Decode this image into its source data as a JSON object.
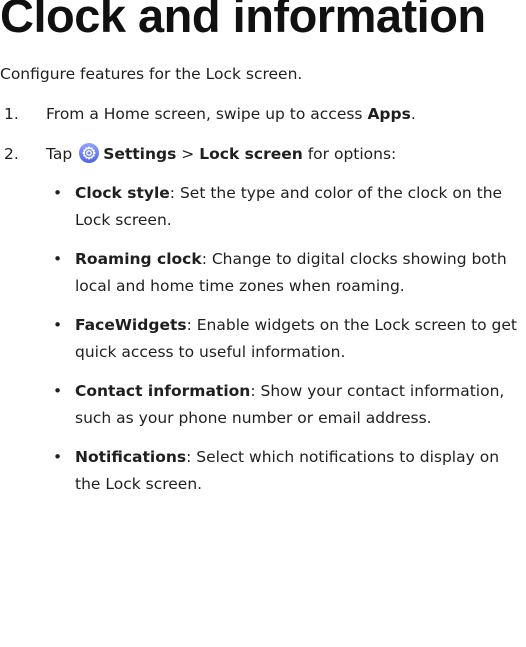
{
  "title": "Clock and information",
  "intro": "Configure features for the Lock screen.",
  "steps": [
    {
      "number": "1.",
      "text": "From a Home screen, swipe up to access ",
      "bold": "Apps",
      "suffix": "."
    },
    {
      "number": "2.",
      "tap": "Tap",
      "icon": "settings-gear-icon",
      "settings": "Settings",
      "separator": ">",
      "lock_screen": "Lock screen",
      "suffix": "for options:"
    }
  ],
  "bullets": [
    {
      "term": "Clock style",
      "desc": ": Set the type and color of the clock on the Lock screen."
    },
    {
      "term": "Roaming clock",
      "desc": ": Change to digital clocks showing both local and home time zones when roaming."
    },
    {
      "term": "FaceWidgets",
      "desc": ": Enable widgets on the Lock screen to get quick access to useful information."
    },
    {
      "term": "Contact information",
      "desc": ": Show your contact information, such as your phone number or email address."
    },
    {
      "term": "Notifications",
      "desc": ": Select which notifications to display on the Lock screen."
    }
  ],
  "colors": {
    "icon_gradient_top": "#8fa3ff",
    "icon_gradient_bottom": "#4f63e6"
  }
}
